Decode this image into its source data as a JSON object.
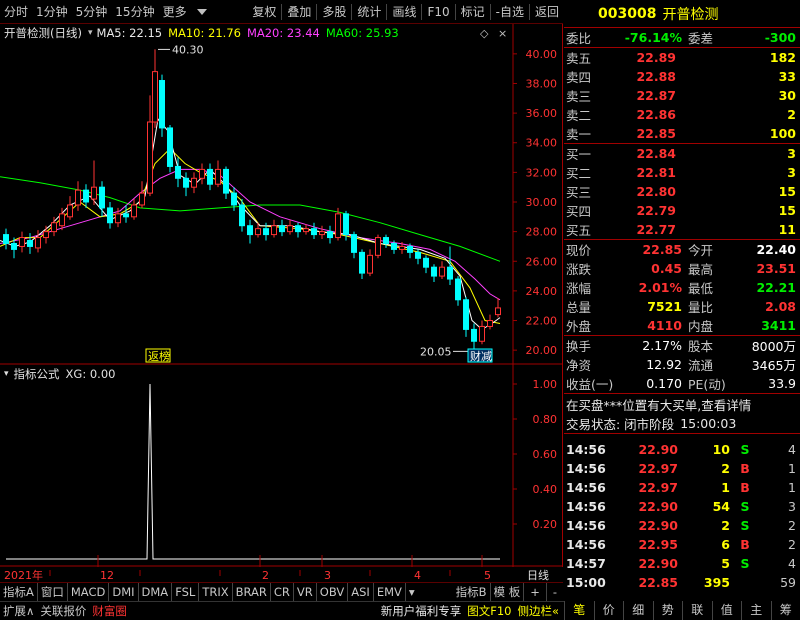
{
  "toolbar": {
    "left": [
      "分时",
      "1分钟",
      "5分钟",
      "15分钟",
      "更多"
    ],
    "right": [
      "复权",
      "叠加",
      "多股",
      "统计",
      "画线",
      "F10",
      "标记",
      "-自选",
      "返回"
    ]
  },
  "legend": {
    "title": "开普检测(日线)",
    "ma5": "MA5: 22.15",
    "ma10": "MA10: 21.76",
    "ma20": "MA20: 23.44",
    "ma60": "MA60: 25.93"
  },
  "indicator_legend": {
    "title": "指标公式",
    "value": "XG: 0.00"
  },
  "chart_labels": {
    "high_label": "40.30",
    "low_label": "20.05",
    "marker1": "返榜",
    "marker2": "财减"
  },
  "chart_data": {
    "type": "candlestick",
    "ylim": [
      19.2,
      40.8
    ],
    "yticks": [
      "40.00",
      "38.00",
      "36.00",
      "34.00",
      "32.00",
      "30.00",
      "28.00",
      "26.00",
      "24.00",
      "22.00",
      "20.00"
    ],
    "indicator_yticks": [
      "1.00",
      "0.80",
      "0.60",
      "0.40",
      "0.20"
    ],
    "x_month_labels": [
      "2021年",
      "12",
      "2",
      "3",
      "4",
      "5"
    ],
    "x_period_label": "日线",
    "colors": {
      "up": "#ff3333",
      "down": "#00ffff",
      "ma5": "#ffffff",
      "ma10": "#ffff00",
      "ma20": "#ff40ff",
      "ma60": "#00ff00",
      "axis": "#a00000"
    },
    "ma60": [
      [
        0,
        31.7
      ],
      [
        40,
        31.3
      ],
      [
        80,
        30.8
      ],
      [
        110,
        30.3
      ],
      [
        140,
        29.6
      ],
      [
        180,
        29.4
      ],
      [
        220,
        29.6
      ],
      [
        260,
        29.8
      ],
      [
        300,
        29.8
      ],
      [
        340,
        29.3
      ],
      [
        380,
        28.6
      ],
      [
        420,
        27.8
      ],
      [
        460,
        27.0
      ],
      [
        500,
        26.0
      ]
    ],
    "ma20": [
      [
        0,
        27.2
      ],
      [
        30,
        27.6
      ],
      [
        60,
        28.2
      ],
      [
        90,
        28.8
      ],
      [
        120,
        29.4
      ],
      [
        140,
        30.6
      ],
      [
        160,
        31.6
      ],
      [
        180,
        32.2
      ],
      [
        200,
        32.2
      ],
      [
        220,
        31.8
      ],
      [
        250,
        30.0
      ],
      [
        280,
        29.0
      ],
      [
        320,
        28.2
      ],
      [
        360,
        27.6
      ],
      [
        400,
        27.2
      ],
      [
        430,
        26.8
      ],
      [
        455,
        26.0
      ],
      [
        475,
        24.8
      ],
      [
        490,
        23.8
      ],
      [
        500,
        23.4
      ]
    ],
    "ma10": [
      [
        0,
        27.0
      ],
      [
        20,
        27.6
      ],
      [
        40,
        27.6
      ],
      [
        60,
        28.8
      ],
      [
        80,
        30.0
      ],
      [
        100,
        29.0
      ],
      [
        120,
        29.2
      ],
      [
        140,
        30.0
      ],
      [
        155,
        32.6
      ],
      [
        170,
        33.6
      ],
      [
        185,
        32.6
      ],
      [
        200,
        32.0
      ],
      [
        220,
        31.4
      ],
      [
        240,
        30.2
      ],
      [
        260,
        28.4
      ],
      [
        300,
        28.2
      ],
      [
        340,
        27.8
      ],
      [
        380,
        27.2
      ],
      [
        420,
        26.6
      ],
      [
        450,
        26.0
      ],
      [
        470,
        24.2
      ],
      [
        485,
        22.0
      ],
      [
        500,
        21.8
      ]
    ],
    "ma5": [
      [
        0,
        27.4
      ],
      [
        15,
        27.0
      ],
      [
        30,
        27.3
      ],
      [
        50,
        28.4
      ],
      [
        70,
        29.8
      ],
      [
        90,
        30.4
      ],
      [
        110,
        28.8
      ],
      [
        130,
        29.4
      ],
      [
        145,
        30.4
      ],
      [
        158,
        35.6
      ],
      [
        168,
        34.8
      ],
      [
        180,
        31.8
      ],
      [
        195,
        31.2
      ],
      [
        210,
        32.2
      ],
      [
        225,
        31.2
      ],
      [
        240,
        29.8
      ],
      [
        260,
        28.4
      ],
      [
        290,
        28.4
      ],
      [
        320,
        28.0
      ],
      [
        350,
        27.8
      ],
      [
        380,
        27.2
      ],
      [
        420,
        26.8
      ],
      [
        445,
        26.2
      ],
      [
        460,
        25.0
      ],
      [
        472,
        22.0
      ],
      [
        482,
        21.4
      ],
      [
        492,
        21.8
      ],
      [
        500,
        22.2
      ]
    ],
    "candles": [
      [
        6,
        27.8,
        27.2,
        28.2,
        26.8
      ],
      [
        14,
        27.2,
        26.8,
        27.6,
        26.2
      ],
      [
        22,
        27.0,
        27.6,
        28.0,
        26.6
      ],
      [
        30,
        27.4,
        27.0,
        27.9,
        26.5
      ],
      [
        38,
        26.9,
        27.6,
        28.1,
        26.6
      ],
      [
        46,
        27.6,
        28.0,
        28.4,
        27.2
      ],
      [
        54,
        28.0,
        28.6,
        29.0,
        27.7
      ],
      [
        62,
        28.4,
        29.2,
        29.6,
        28.1
      ],
      [
        70,
        29.0,
        29.8,
        30.4,
        28.8
      ],
      [
        78,
        29.8,
        30.8,
        31.4,
        29.4
      ],
      [
        86,
        30.8,
        30.0,
        31.2,
        29.6
      ],
      [
        94,
        30.2,
        31.0,
        32.8,
        29.8
      ],
      [
        102,
        31.0,
        29.6,
        31.4,
        29.0
      ],
      [
        110,
        29.6,
        28.6,
        30.0,
        28.2
      ],
      [
        118,
        28.6,
        29.2,
        29.6,
        28.3
      ],
      [
        126,
        29.2,
        29.0,
        29.8,
        28.6
      ],
      [
        134,
        29.0,
        29.8,
        30.2,
        28.8
      ],
      [
        142,
        29.8,
        30.6,
        31.4,
        29.6
      ],
      [
        150,
        30.6,
        35.4,
        37.2,
        30.4
      ],
      [
        155,
        35.4,
        38.8,
        40.3,
        35.0
      ],
      [
        162,
        38.2,
        35.0,
        38.6,
        34.4
      ],
      [
        170,
        35.0,
        32.4,
        35.2,
        32.0
      ],
      [
        178,
        32.4,
        31.6,
        33.0,
        31.0
      ],
      [
        186,
        31.6,
        31.0,
        32.0,
        30.4
      ],
      [
        194,
        31.0,
        31.6,
        32.0,
        30.6
      ],
      [
        202,
        31.6,
        32.2,
        32.6,
        31.2
      ],
      [
        210,
        32.2,
        31.2,
        32.6,
        30.8
      ],
      [
        218,
        31.2,
        32.2,
        32.8,
        31.0
      ],
      [
        226,
        32.2,
        30.6,
        32.4,
        30.2
      ],
      [
        234,
        30.6,
        29.8,
        31.0,
        29.4
      ],
      [
        242,
        29.8,
        28.4,
        30.2,
        28.0
      ],
      [
        250,
        28.4,
        27.8,
        28.8,
        27.2
      ],
      [
        258,
        27.8,
        28.2,
        28.6,
        27.6
      ],
      [
        266,
        28.2,
        27.8,
        28.6,
        27.4
      ],
      [
        274,
        27.8,
        28.4,
        28.8,
        27.6
      ],
      [
        282,
        28.4,
        28.0,
        28.8,
        27.7
      ],
      [
        290,
        28.0,
        28.4,
        28.8,
        27.8
      ],
      [
        298,
        28.4,
        28.0,
        28.6,
        27.6
      ],
      [
        306,
        28.0,
        28.2,
        28.5,
        27.8
      ],
      [
        314,
        28.2,
        27.8,
        28.6,
        27.5
      ],
      [
        322,
        27.8,
        28.0,
        28.4,
        27.5
      ],
      [
        330,
        28.0,
        27.6,
        28.4,
        27.2
      ],
      [
        338,
        27.6,
        29.2,
        29.6,
        27.4
      ],
      [
        346,
        29.2,
        27.8,
        29.4,
        27.4
      ],
      [
        354,
        27.8,
        26.6,
        28.0,
        26.2
      ],
      [
        362,
        26.6,
        25.2,
        26.8,
        24.8
      ],
      [
        370,
        25.2,
        26.4,
        26.8,
        25.0
      ],
      [
        378,
        26.4,
        27.6,
        27.8,
        26.2
      ],
      [
        386,
        27.6,
        27.2,
        27.8,
        26.9
      ],
      [
        394,
        27.2,
        26.8,
        27.4,
        26.5
      ],
      [
        402,
        26.8,
        27.0,
        27.3,
        26.5
      ],
      [
        410,
        27.0,
        26.6,
        27.2,
        26.2
      ],
      [
        418,
        26.6,
        26.2,
        26.8,
        25.8
      ],
      [
        426,
        26.2,
        25.6,
        26.4,
        25.2
      ],
      [
        434,
        25.6,
        25.0,
        25.8,
        24.6
      ],
      [
        442,
        25.0,
        25.6,
        26.0,
        24.8
      ],
      [
        450,
        25.6,
        24.8,
        27.0,
        24.4
      ],
      [
        458,
        24.8,
        23.4,
        25.0,
        23.0
      ],
      [
        466,
        23.4,
        21.4,
        23.6,
        20.9
      ],
      [
        474,
        21.4,
        20.6,
        21.8,
        20.05
      ],
      [
        482,
        20.6,
        21.6,
        22.0,
        20.4
      ],
      [
        490,
        21.6,
        22.0,
        22.4,
        21.4
      ],
      [
        498,
        22.4,
        22.85,
        23.51,
        22.21
      ]
    ],
    "signal": {
      "x": 150,
      "value": 1.0
    }
  },
  "bottom_tabs": [
    "指标A",
    "窗口",
    "MACD",
    "DMI",
    "DMA",
    "FSL",
    "TRIX",
    "BRAR",
    "CR",
    "VR",
    "OBV",
    "ASI",
    "EMV"
  ],
  "bottom_tabs_right": [
    "指标B",
    "模 板",
    "+",
    "-"
  ],
  "bottom_bar": {
    "left": [
      "扩展∧",
      "关联报价",
      "财富圈"
    ],
    "right": [
      "新用户福利专享",
      "图文F10",
      "侧边栏«"
    ]
  },
  "stock": {
    "code": "003008",
    "name": "开普检测"
  },
  "commission": {
    "label1": "委比",
    "value1": "-76.14%",
    "label2": "委差",
    "value2": "-300"
  },
  "sell_orders": [
    {
      "label": "卖五",
      "price": "22.89",
      "vol": "182"
    },
    {
      "label": "卖四",
      "price": "22.88",
      "vol": "33"
    },
    {
      "label": "卖三",
      "price": "22.87",
      "vol": "30"
    },
    {
      "label": "卖二",
      "price": "22.86",
      "vol": "2"
    },
    {
      "label": "卖一",
      "price": "22.85",
      "vol": "100"
    }
  ],
  "buy_orders": [
    {
      "label": "买一",
      "price": "22.84",
      "vol": "3"
    },
    {
      "label": "买二",
      "price": "22.81",
      "vol": "3"
    },
    {
      "label": "买三",
      "price": "22.80",
      "vol": "15"
    },
    {
      "label": "买四",
      "price": "22.79",
      "vol": "15"
    },
    {
      "label": "买五",
      "price": "22.77",
      "vol": "11"
    }
  ],
  "quote": [
    {
      "l1": "现价",
      "v1": "22.85",
      "c1": "red",
      "l2": "今开",
      "v2": "22.40",
      "c2": "white"
    },
    {
      "l1": "涨跌",
      "v1": "0.45",
      "c1": "red",
      "l2": "最高",
      "v2": "23.51",
      "c2": "red"
    },
    {
      "l1": "涨幅",
      "v1": "2.01%",
      "c1": "red",
      "l2": "最低",
      "v2": "22.21",
      "c2": "green"
    },
    {
      "l1": "总量",
      "v1": "7521",
      "c1": "yellow",
      "l2": "量比",
      "v2": "2.08",
      "c2": "red"
    },
    {
      "l1": "外盘",
      "v1": "4110",
      "c1": "red",
      "l2": "内盘",
      "v2": "3411",
      "c2": "green"
    }
  ],
  "fundamentals": [
    {
      "l1": "换手",
      "v1": "2.17%",
      "l2": "股本",
      "v2": "8000万"
    },
    {
      "l1": "净资",
      "v1": "12.92",
      "l2": "流通",
      "v2": "3465万"
    },
    {
      "l1": "收益(一)",
      "v1": "0.170",
      "l2": "PE(动)",
      "v2": "33.9"
    }
  ],
  "notice": "在买盘***位置有大买单,查看详情",
  "trade_status": {
    "label": "交易状态: 闭市阶段",
    "time": "15:00:03"
  },
  "ticks": [
    {
      "time": "14:56",
      "price": "22.90",
      "vol": "10",
      "bs": "S",
      "n": "4"
    },
    {
      "time": "14:56",
      "price": "22.97",
      "vol": "2",
      "bs": "B",
      "n": "1"
    },
    {
      "time": "14:56",
      "price": "22.97",
      "vol": "1",
      "bs": "B",
      "n": "1"
    },
    {
      "time": "14:56",
      "price": "22.90",
      "vol": "54",
      "bs": "S",
      "n": "3"
    },
    {
      "time": "14:56",
      "price": "22.90",
      "vol": "2",
      "bs": "S",
      "n": "2"
    },
    {
      "time": "14:56",
      "price": "22.95",
      "vol": "6",
      "bs": "B",
      "n": "2"
    },
    {
      "time": "14:57",
      "price": "22.90",
      "vol": "5",
      "bs": "S",
      "n": "4"
    },
    {
      "time": "15:00",
      "price": "22.85",
      "vol": "395",
      "bs": "",
      "n": "59"
    }
  ],
  "panel_tabs": [
    "笔",
    "价",
    "细",
    "势",
    "联",
    "值",
    "主",
    "筹"
  ]
}
